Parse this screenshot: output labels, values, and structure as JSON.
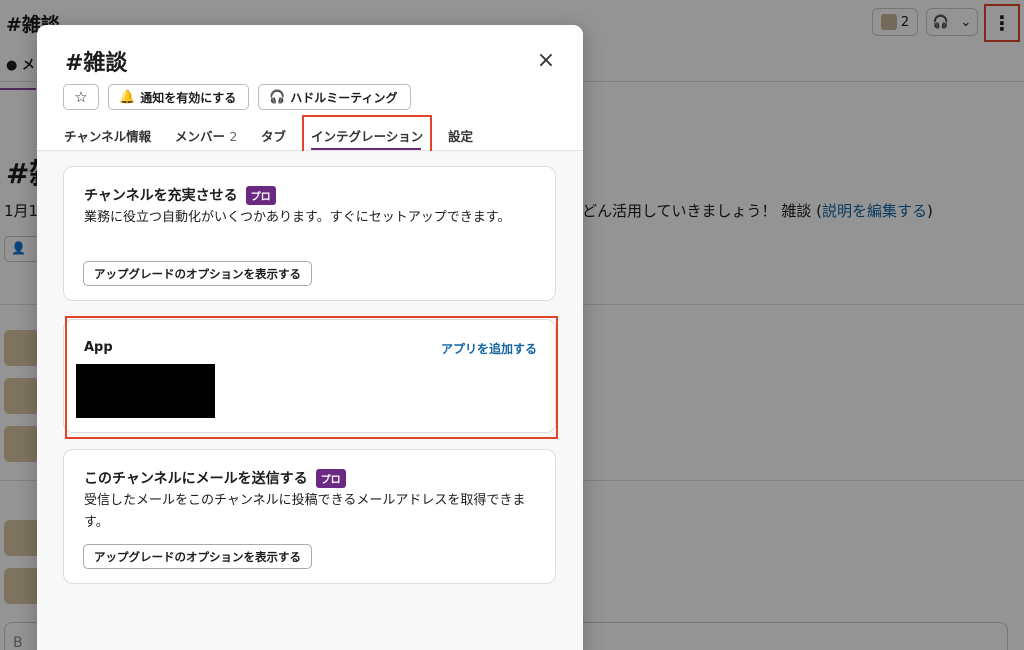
{
  "background": {
    "channel_title": "#雑談",
    "tab_partial": "メ",
    "members_count": "2",
    "big_hash": "#雑",
    "description_left": "1月1",
    "description_right": "どん活用していきましょう！ 雑談 (",
    "description_link": "説明を編集する",
    "description_close": ")",
    "composer_placeholder": "B"
  },
  "modal": {
    "title": "#雑談",
    "close_icon": "×",
    "buttons": {
      "star_icon": "☆",
      "notify_icon": "🔔",
      "notify_label": "通知を有効にする",
      "huddle_icon": "🎧",
      "huddle_label": "ハドルミーティング"
    },
    "tabs": [
      {
        "label": "チャンネル情報"
      },
      {
        "label": "メンバー",
        "count": "2"
      },
      {
        "label": "タブ"
      },
      {
        "label": "インテグレーション"
      },
      {
        "label": "設定"
      }
    ],
    "cards": {
      "enrich": {
        "title": "チャンネルを充実させる",
        "badge": "プロ",
        "text": "業務に役立つ自動化がいくつかあります。すぐにセットアップできます。",
        "button": "アップグレードのオプションを表示する"
      },
      "app": {
        "label": "App",
        "add_link": "アプリを追加する"
      },
      "email": {
        "title": "このチャンネルにメールを送信する",
        "badge": "プロ",
        "text": "受信したメールをこのチャンネルに投稿できるメールアドレスを取得できます。",
        "button": "アップグレードのオプションを表示する"
      }
    }
  },
  "colors": {
    "accent_purple": "#6b2a82",
    "link_blue": "#1264a3",
    "highlight_red": "#e0452a"
  }
}
